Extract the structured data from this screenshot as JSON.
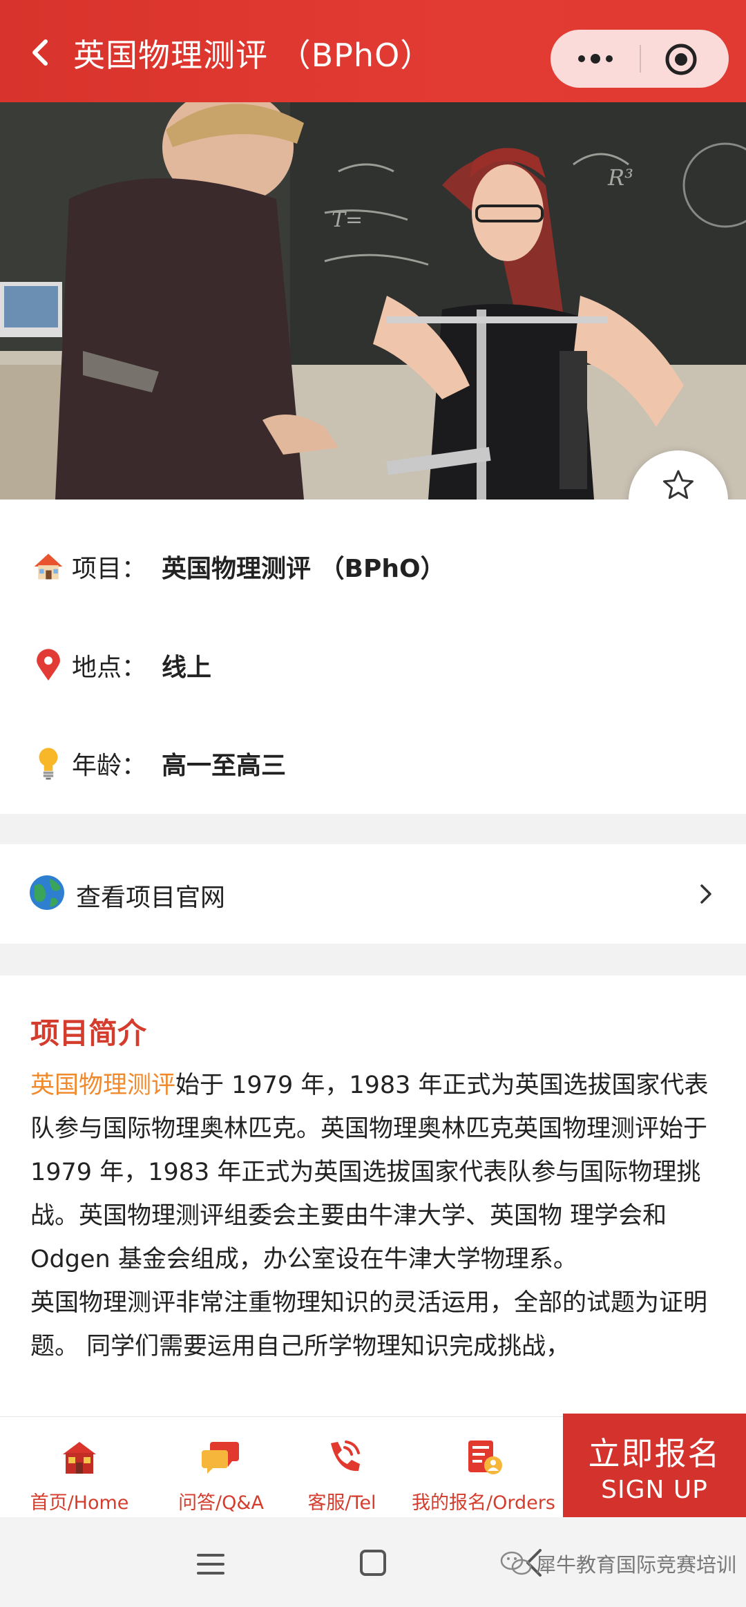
{
  "header": {
    "title": "英国物理测评 （BPhO）"
  },
  "favorite": {
    "label": "收藏"
  },
  "info": {
    "project": {
      "label": "项目：",
      "value": "英国物理测评 （BPhO）"
    },
    "location": {
      "label": "地点：",
      "value": "线上"
    },
    "age": {
      "label": "年龄：",
      "value": "高一至高三"
    }
  },
  "website": {
    "label": "查看项目官网"
  },
  "intro": {
    "heading": "项目简介",
    "highlight": "英国物理测评",
    "text1": "始于 1979 年，1983 年正式为英国选拔国家代表队参与国际物理奥林匹克。英国物理奥林匹克英国物理测评始于 1979 年，1983 年正式为英国选拔国家代表队参与国际物理挑战。英国物理测评组委会主要由牛津大学、英国物 理学会和 Odgen 基金会组成，办公室设在牛津大学物理系。",
    "text2": "英国物理测评非常注重物理知识的灵活运用，全部的试题为证明题。 同学们需要运用自己所学物理知识完成挑战，"
  },
  "tabbar": {
    "home": "首页/Home",
    "qa": "问答/Q&A",
    "tel": "客服/Tel",
    "orders": "我的报名/Orders",
    "signup_cn": "立即报名",
    "signup_en": "SIGN UP"
  },
  "watermark": {
    "text": "犀牛教育国际竞赛培训"
  },
  "colors": {
    "brand_red": "#d8332c",
    "highlight_orange": "#f08a2c",
    "heading_red": "#d43d2d"
  }
}
